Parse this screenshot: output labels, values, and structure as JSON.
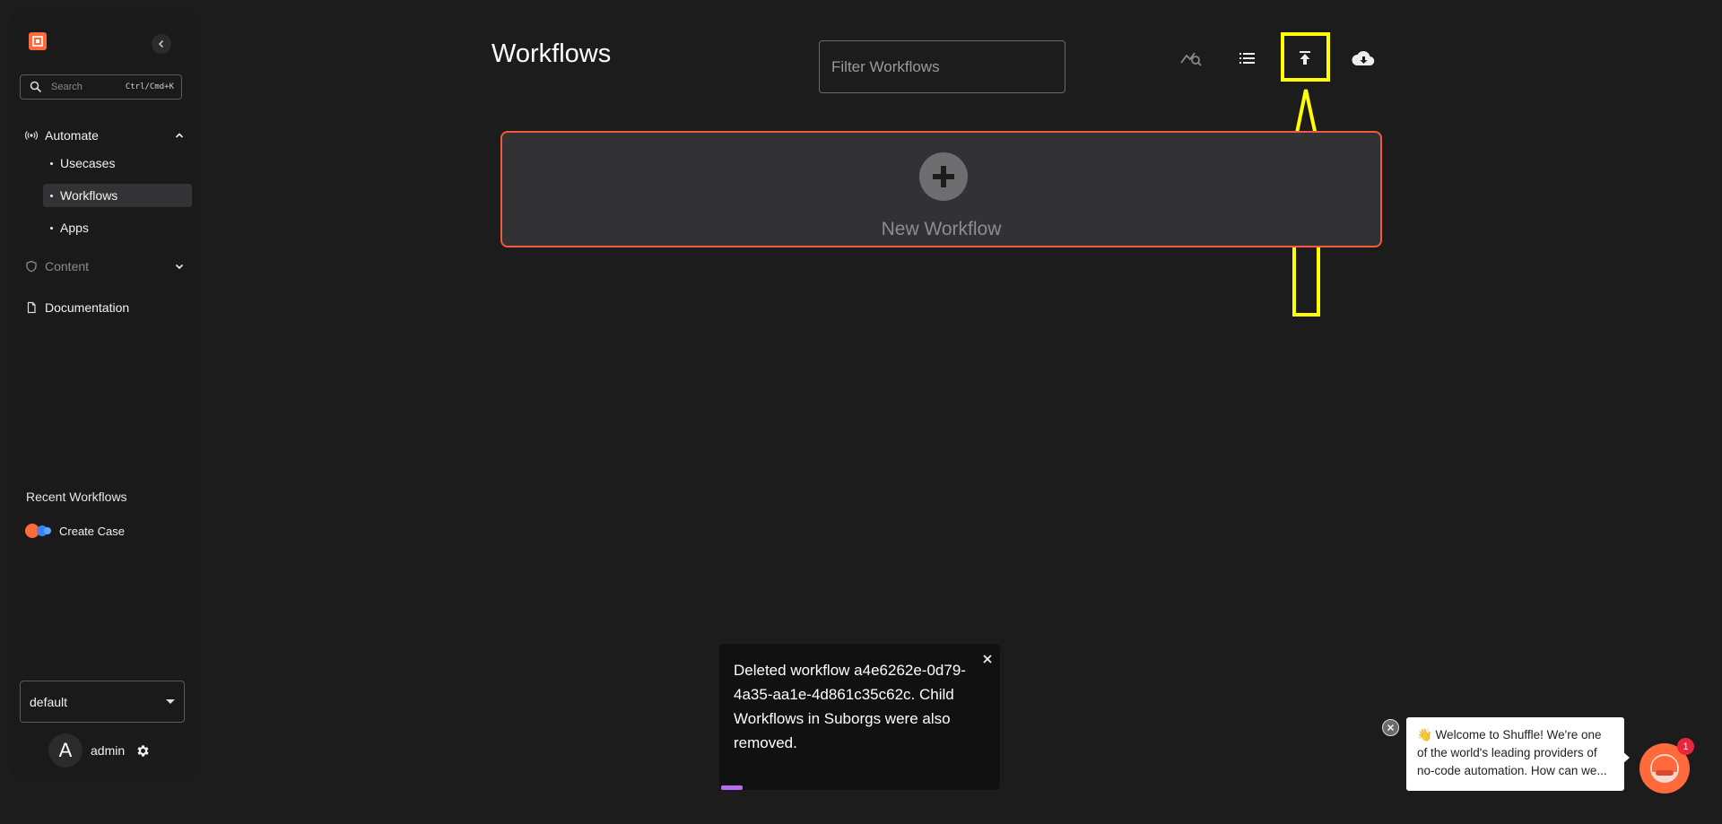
{
  "sidebar": {
    "search": {
      "placeholder": "Search",
      "shortcut": "Ctrl/Cmd+K"
    },
    "sections": {
      "automate": {
        "label": "Automate",
        "items": [
          {
            "label": "Usecases"
          },
          {
            "label": "Workflows",
            "active": true
          },
          {
            "label": "Apps"
          }
        ]
      },
      "content": {
        "label": "Content"
      },
      "documentation": {
        "label": "Documentation"
      }
    },
    "recent": {
      "title": "Recent Workflows",
      "items": [
        {
          "label": "Create Case"
        }
      ]
    },
    "org": {
      "value": "default"
    },
    "user": {
      "initial": "A",
      "name": "admin"
    }
  },
  "main": {
    "title": "Workflows",
    "filter": {
      "placeholder": "Filter Workflows",
      "value": ""
    },
    "toolbar": {
      "icons": [
        "search-chart-icon",
        "list-view-icon",
        "upload-icon",
        "cloud-download-icon"
      ]
    },
    "new_workflow": {
      "label": "New Workflow"
    }
  },
  "toast": {
    "message": "Deleted workflow a4e6262e-0d79-4a35-aa1e-4d861c35c62c. Child Workflows in Suborgs were also removed."
  },
  "chat": {
    "message": "👋 Welcome to Shuffle! We're one of the world's leading providers of no-code automation. How can we...",
    "badge": "1"
  },
  "colors": {
    "accent": "#f15a3a",
    "highlight": "#ffff00",
    "background": "#1c1c1d",
    "progress": "#b46cf0"
  }
}
